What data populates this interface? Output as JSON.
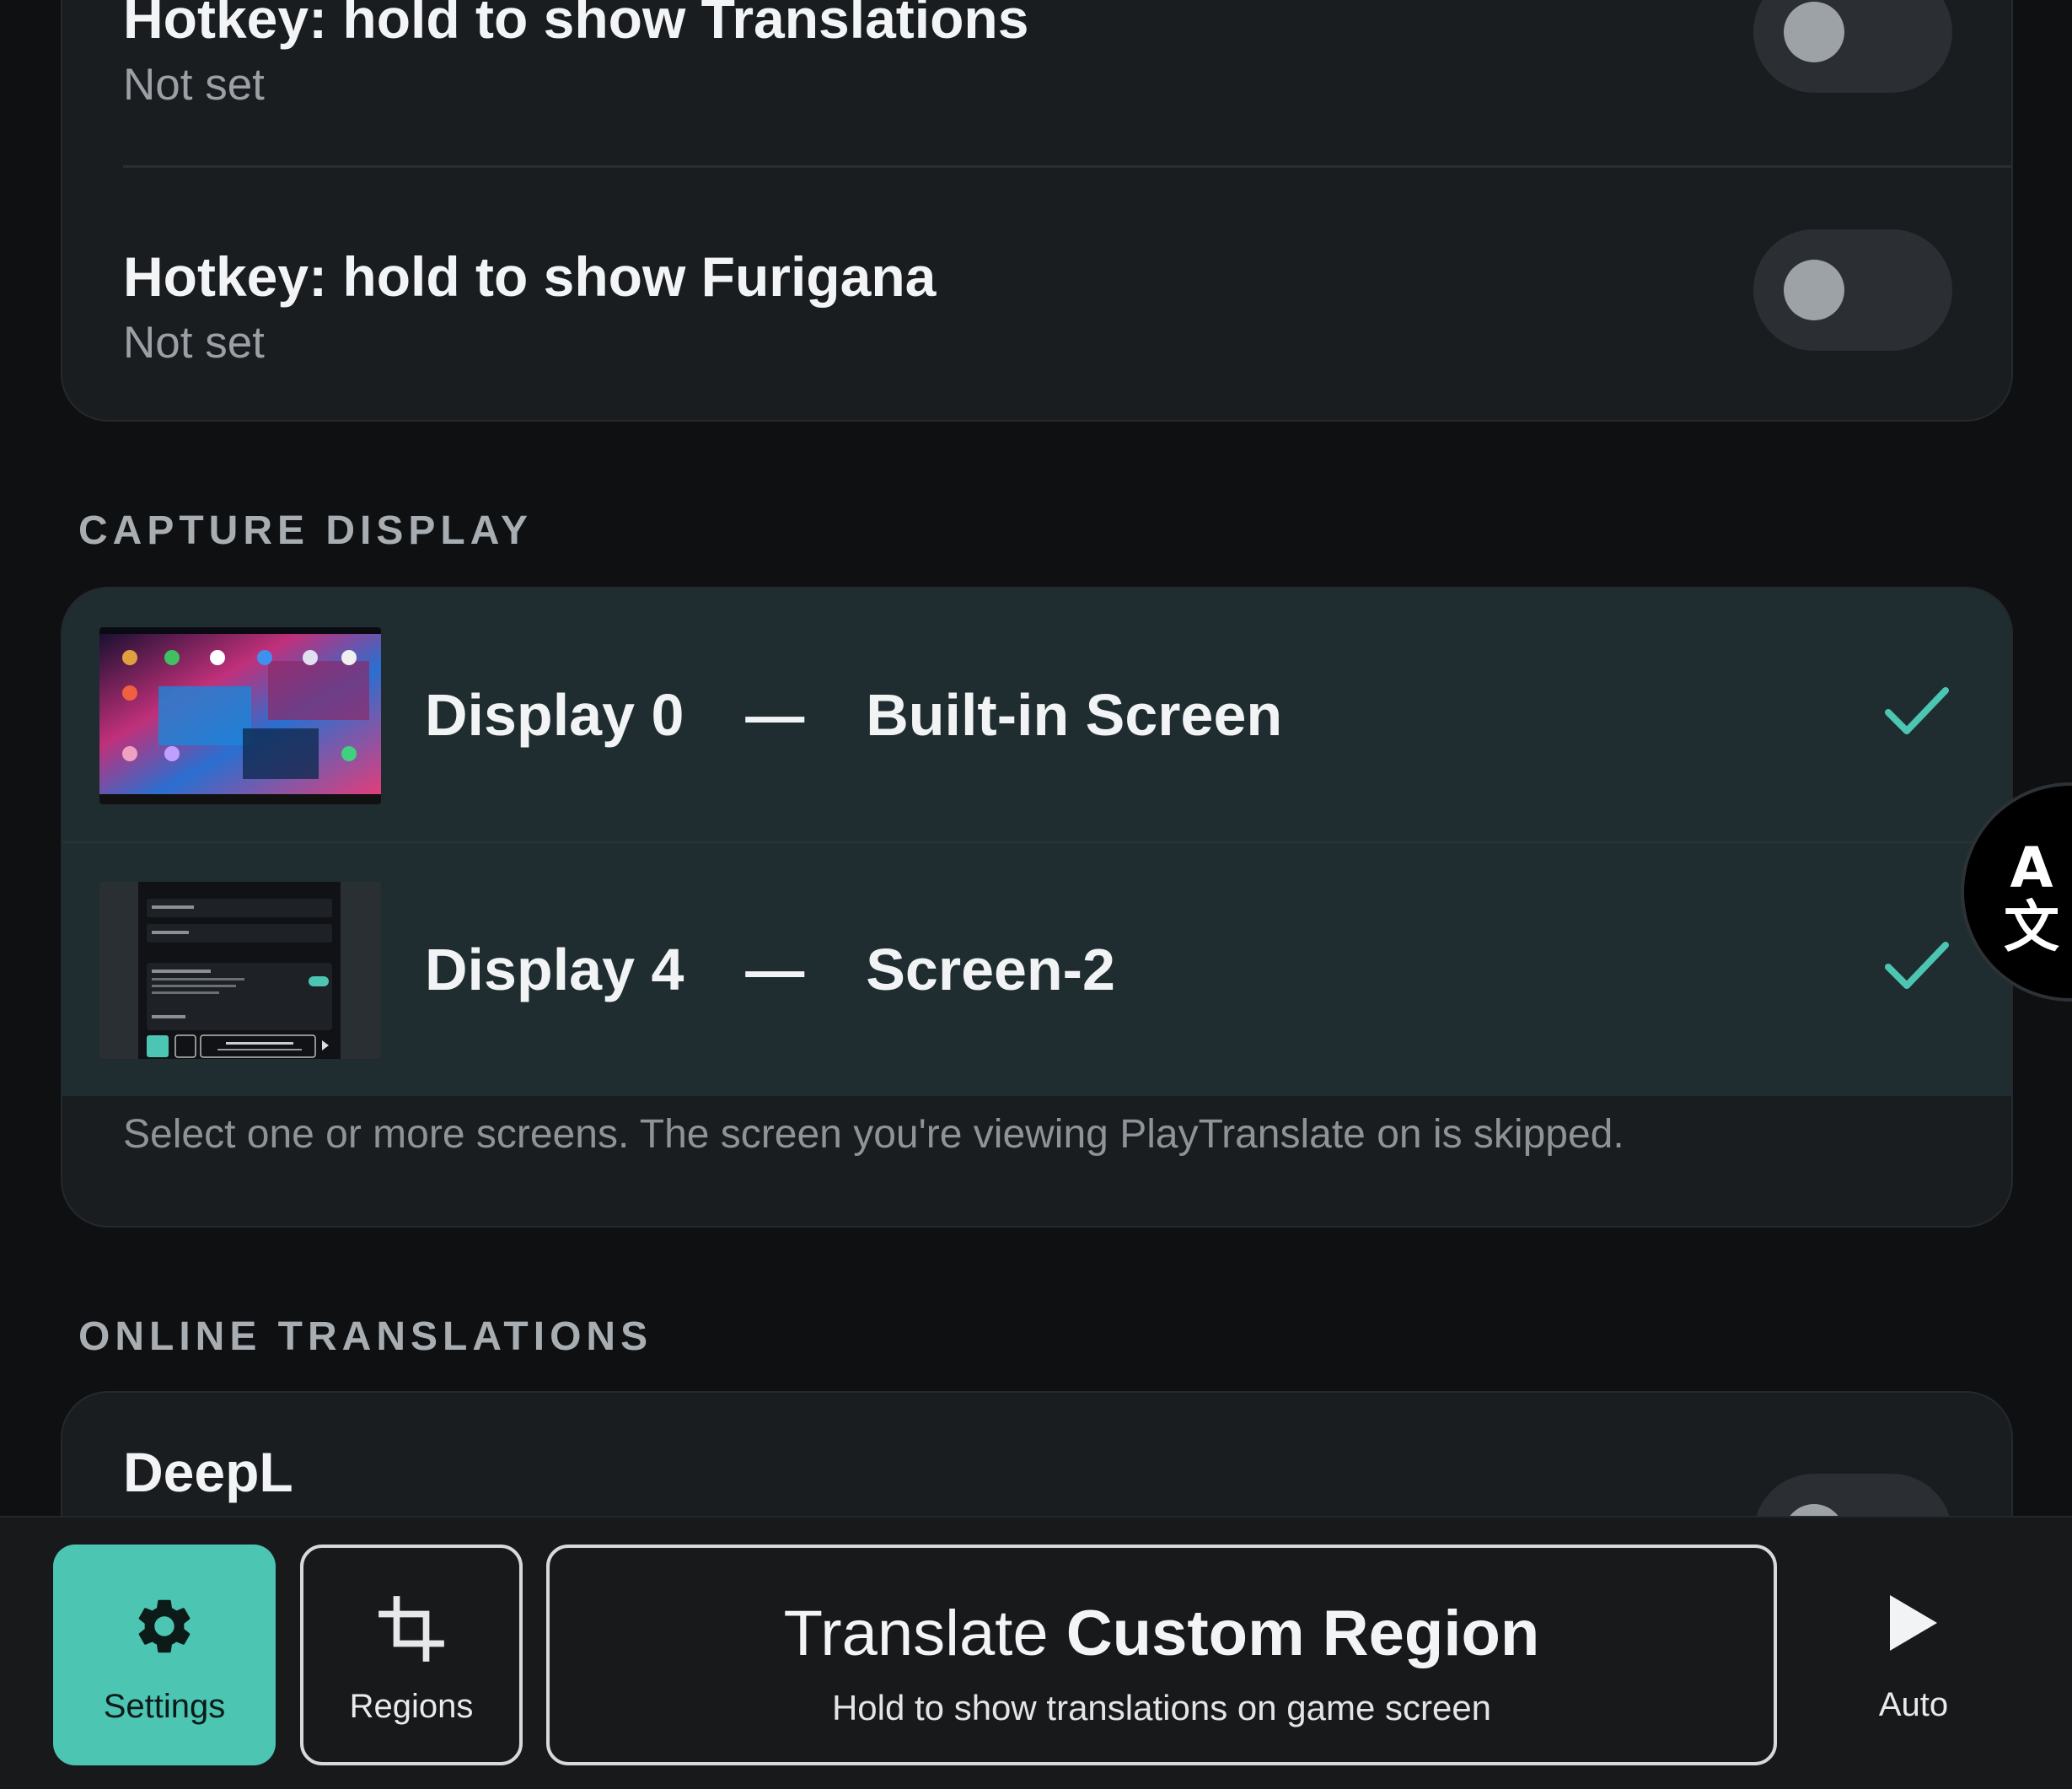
{
  "hotkeys": {
    "translations": {
      "title": "Hotkey: hold to show Translations",
      "value": "Not set"
    },
    "furigana": {
      "title": "Hotkey: hold to show Furigana",
      "value": "Not set"
    }
  },
  "capture_display": {
    "header": "CAPTURE DISPLAY",
    "displays": [
      {
        "id": "Display 0",
        "name": "Built-in Screen",
        "selected": true
      },
      {
        "id": "Display 4",
        "name": "Screen-2",
        "selected": true
      }
    ],
    "separator": "—",
    "hint": "Select one or more screens. The screen you're viewing PlayTranslate on is skipped."
  },
  "online_translations": {
    "header": "ONLINE TRANSLATIONS",
    "deepl_title": "DeepL"
  },
  "floating_button": {
    "top_glyph": "A",
    "bottom_glyph": "文"
  },
  "bottom_bar": {
    "settings_label": "Settings",
    "regions_label": "Regions",
    "translate_prefix": "Translate",
    "translate_emphasis": "Custom Region",
    "translate_sub": "Hold to show translations on game screen",
    "auto_label": "Auto"
  },
  "colors": {
    "accent": "#4cc5b2",
    "background": "#0e1012",
    "card": "#1a1d20",
    "selected_row": "#1f2d30"
  },
  "icons": {
    "settings": "gear-icon",
    "regions": "crop-icon",
    "auto": "play-icon",
    "selected": "check-icon",
    "floating": "translate-icon"
  }
}
